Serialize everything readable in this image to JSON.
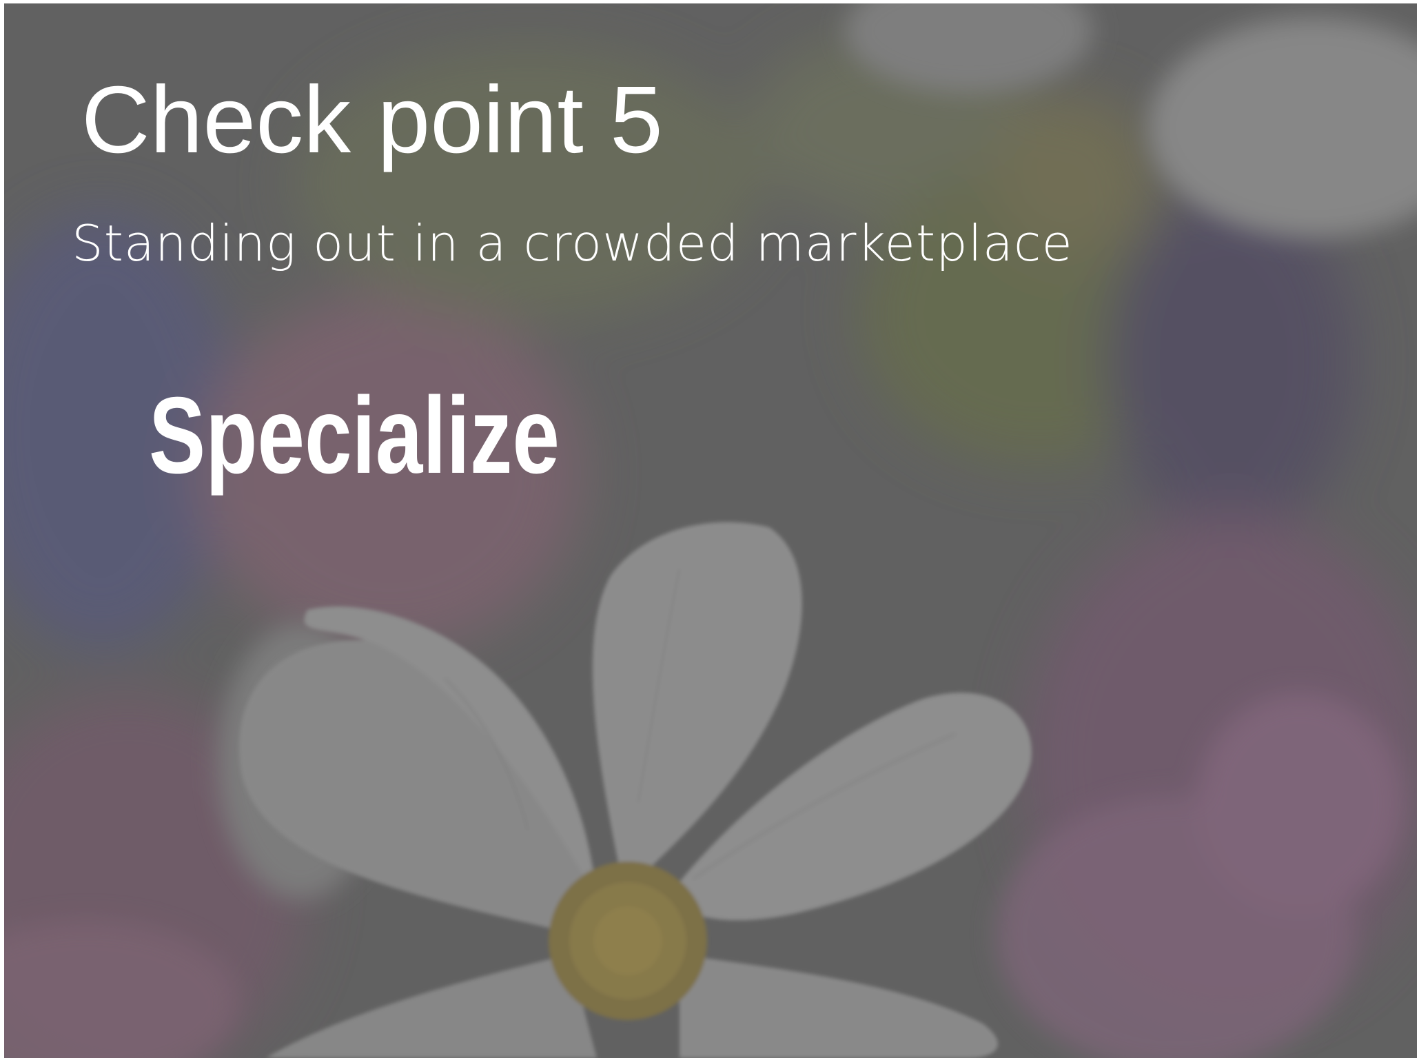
{
  "slide": {
    "title": "Check point 5",
    "subtitle": "Standing out in a crowded marketplace",
    "headline": "Specialize"
  },
  "background": {
    "image": "flowers-photo",
    "tint": "#666666"
  }
}
